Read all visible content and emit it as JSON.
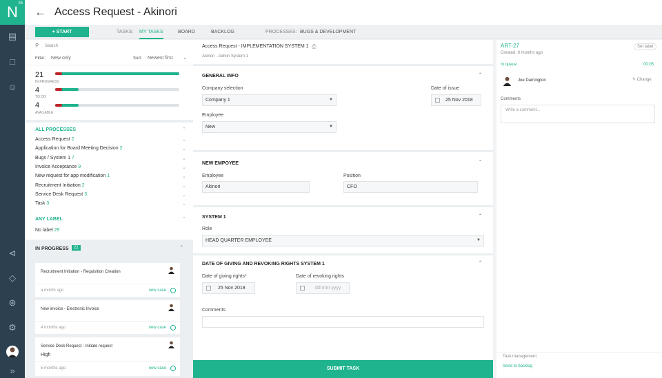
{
  "app": {
    "logo": "N",
    "badge": "25",
    "title": "Access Request - Akinori"
  },
  "rail": {
    "icons": [
      "chart-icon",
      "folder-icon",
      "user-icon",
      "share-icon",
      "layers-icon",
      "team-icon",
      "gear-icon",
      "expand-icon"
    ]
  },
  "tabs": {
    "start": "+    START",
    "tasks_label": "TASKS:",
    "my_tasks": "MY TASKS",
    "board": "BOARD",
    "backlog": "BACKLOG",
    "processes_label": "PROCESSES:",
    "process": "BUGS & DEVELOPMENT"
  },
  "left": {
    "search": "Search",
    "filter_label": "Filter:",
    "filter_value": "New only",
    "sort_label": "Sort:",
    "sort_value": "Newest first",
    "counts": [
      {
        "value": "21",
        "label": "IN PROGRESS",
        "fill": 1.0
      },
      {
        "value": "4",
        "label": "TO DO",
        "fill": 0.19
      },
      {
        "value": "4",
        "label": "AVAILABLE",
        "fill": 0.19
      }
    ],
    "all_processes": "ALL PROCESSES",
    "processes": [
      {
        "name": "Access Request",
        "count": "2"
      },
      {
        "name": "Application for Board Meeting Decision",
        "count": "2"
      },
      {
        "name": "Bugs / System 1",
        "count": "7"
      },
      {
        "name": "Invoice Acceptance",
        "count": "9"
      },
      {
        "name": "New request for app modification",
        "count": "1"
      },
      {
        "name": "Recruitment Initiation",
        "count": "2"
      },
      {
        "name": "Service Desk Request",
        "count": "3"
      },
      {
        "name": "Task",
        "count": "3"
      }
    ],
    "any_label": "ANY LABEL",
    "no_label": "No label",
    "no_label_count": "29",
    "in_progress": "IN PROGRESS",
    "in_progress_count": "21",
    "cards": [
      {
        "title": "Recruitment Initiation - Requisition Creation",
        "time": "a month ago",
        "tag": "new case",
        "extra": ""
      },
      {
        "title": "New invoice - Electronic Invoice",
        "time": "4 months ago",
        "tag": "new case",
        "extra": ""
      },
      {
        "title": "Service Desk Request - Initiate request",
        "time": "5 months ago",
        "tag": "new case",
        "extra": "High"
      }
    ]
  },
  "main": {
    "header": "Access Request - IMPLEMENTATION SYSTEM 1",
    "sub": "Akinori - Admin System 1",
    "general": "GENERAL INFO",
    "company_label": "Company selection",
    "company": "Company 1",
    "date_label": "Date of issue",
    "date": "25 Nov 2018",
    "employee_label": "Employee",
    "employee": "New",
    "new_emp": "NEW EMPOYEE",
    "emp2_label": "Employee",
    "emp2": "Akinori",
    "pos_label": "Position",
    "pos": "CFO",
    "system": "SYSTEM 1",
    "role_label": "Role",
    "role": "HEAD QUARTER EMPLOYEE",
    "dates": "DATE OF GIVING AND REVOKING RIGHTS SYSTEM 1",
    "giving_label": "Date of giving rights*",
    "giving": "25 Nov 2018",
    "revoking_label": "Date of revoking rights",
    "revoking_ph": "dd mm yyyy",
    "comments_label": "Comments",
    "submit": "SUBMIT TASK"
  },
  "right": {
    "id": "ART-27",
    "created": "Created: 8 months ago",
    "set_label": "Set label",
    "status": "In queue",
    "timer": "00:05",
    "assignee": "Joe Darnington",
    "change": "Change",
    "comments_label": "Comments",
    "comment_ph": "Write a comment...",
    "task_mgmt": "Task management",
    "send": "Send to backlog"
  },
  "colors": {
    "accent": "#1fb38e",
    "rail": "#2c4050",
    "danger": "#c0262d"
  }
}
